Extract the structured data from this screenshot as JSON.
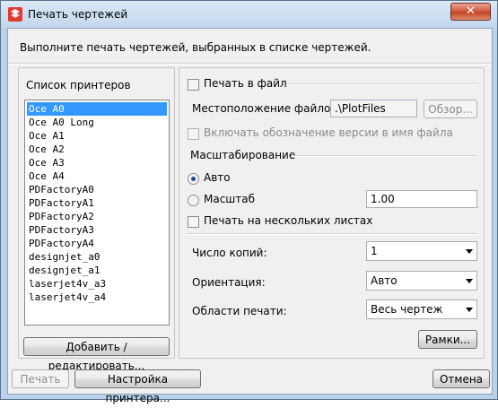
{
  "window": {
    "title": "Печать чертежей",
    "close_glyph": "✕"
  },
  "instruction": "Выполните печать чертежей, выбранных в списке чертежей.",
  "printers": {
    "heading": "Список принтеров",
    "items": [
      "Oce A0",
      "Oce A0 Long",
      "Oce A1",
      "Oce A2",
      "Oce A3",
      "Oce A4",
      "PDFactoryA0",
      "PDFactoryA1",
      "PDFactoryA2",
      "PDFactoryA3",
      "PDFactoryA4",
      "designjet_a0",
      "designjet_a1",
      "laserjet4v_a3",
      "laserjet4v_a4"
    ],
    "selected_index": 0,
    "add_edit_button": "Добавить / редактировать..."
  },
  "print_to_file": {
    "label": "Печать в файл",
    "checked": false,
    "location_label": "Местоположение файлов:",
    "location_value": ".\\PlotFiles",
    "browse_button": "Обзор...",
    "include_version_label": "Включать обозначение версии в имя файла"
  },
  "scaling": {
    "heading": "Масштабирование",
    "auto_label": "Авто",
    "auto_selected": true,
    "scale_label": "Масштаб",
    "scale_value": "1.00",
    "multi_sheet_label": "Печать на нескольких листах"
  },
  "options": {
    "copies_label": "Число копий:",
    "copies_value": "1",
    "orientation_label": "Ориентация:",
    "orientation_value": "Авто",
    "area_label": "Области печати:",
    "area_value": "Весь чертеж",
    "frames_button": "Рамки..."
  },
  "footer": {
    "print_button": "Печать",
    "printer_setup_button": "Настройка принтера...",
    "cancel_button": "Отмена"
  }
}
